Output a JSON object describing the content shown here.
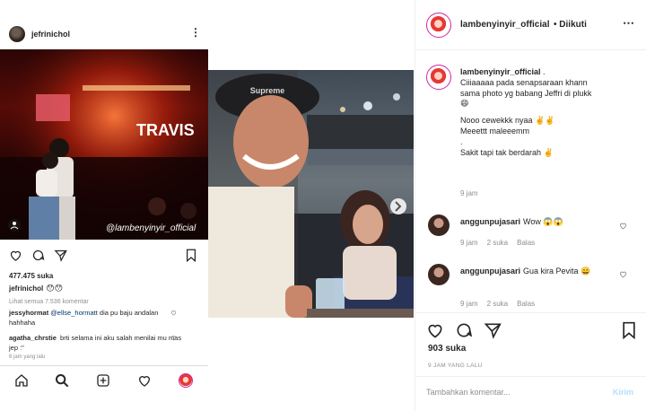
{
  "left_post": {
    "username": "jefrinichol",
    "photo_sign_text": "TRAVIS",
    "watermark": "@lambenyinyir_official",
    "likes": "477.475 suka",
    "caption_user": "jefrinichol",
    "caption_text": "😯😯",
    "view_all_comments": "Lihat semua 7.536 komentar",
    "comments": [
      {
        "user": "jessyhormat",
        "mention": "@ellse_hormatt",
        "text": "dia pu baju andalan hahhaha"
      },
      {
        "user": "agatha_chrstie",
        "mention": "",
        "text": "brti selama ini aku salah menilai mu mas jep :\""
      }
    ],
    "timestamp": "6 jam yang lalu"
  },
  "video": {
    "cap_text": "Supreme"
  },
  "right_panel": {
    "username": "lambenyinyir_official",
    "separator": "•",
    "follow_status": "Diikuti",
    "caption_user": "lambenyinyir_official",
    "caption_lines": [
      "Ciiiaaaaa pada senapsaraan khann",
      "sama photo yg babang Jeffri di plukk",
      "😄",
      "",
      "Nooo cewekkk nyaa ✌️✌️",
      "Meeettt maleeemm",
      ".",
      "Sakit tapi tak berdarah ✌️"
    ],
    "caption_time": "9 jam",
    "comments": [
      {
        "user": "anggunpujasari",
        "text": "Wow 😱😱",
        "time": "9 jam",
        "likes": "2 suka",
        "reply": "Balas"
      },
      {
        "user": "anggunpujasari",
        "text": "Gua kira Pevita 😄",
        "time": "9 jam",
        "likes": "2 suka",
        "reply": "Balas"
      }
    ],
    "likes": "903 suka",
    "date": "9 JAM YANG LALU",
    "input_placeholder": "Tambahkan komentar...",
    "post_label": "Kirim"
  },
  "colors": {
    "link_blue": "#00376b",
    "post_button_disabled": "#b2dffc",
    "secondary_text": "#8e8e8e",
    "border": "#efefef",
    "concert_red": "#5a0c08"
  },
  "icons": [
    "more-icon",
    "heart-icon",
    "comment-icon",
    "share-icon",
    "bookmark-icon",
    "home-icon",
    "search-icon",
    "add-icon",
    "activity-icon",
    "next-arrow-icon"
  ]
}
